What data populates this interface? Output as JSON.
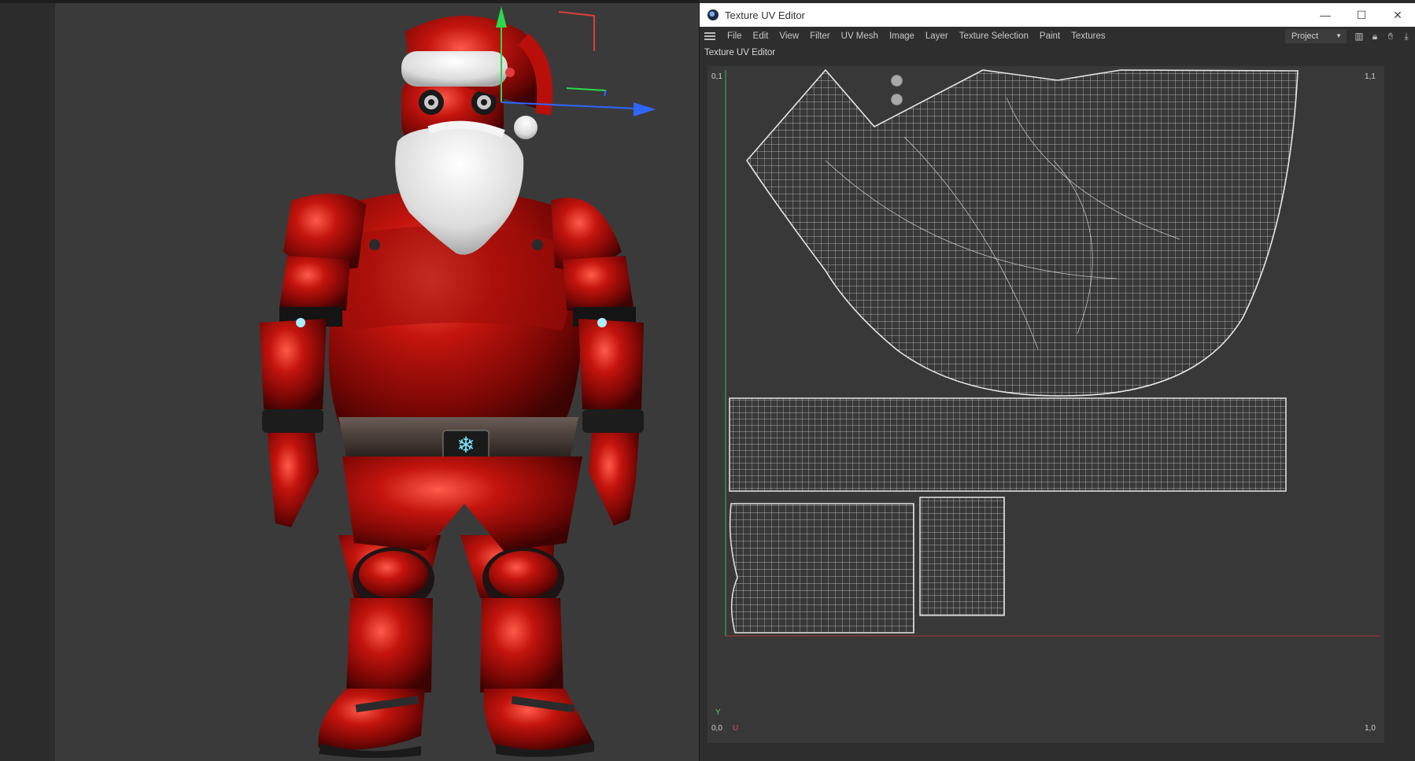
{
  "window": {
    "title": "Texture UV Editor",
    "minimize": "—",
    "maximize": "☐",
    "close": "✕"
  },
  "menu": [
    "File",
    "Edit",
    "View",
    "Filter",
    "UV Mesh",
    "Image",
    "Layer",
    "Texture Selection",
    "Paint",
    "Textures"
  ],
  "project_select": "Project",
  "toolbar_icons": [
    "histogram-icon",
    "lock-icon",
    "hand-icon",
    "pin-icon"
  ],
  "panel_title": "Texture UV Editor",
  "axis": {
    "top_left": "0,1",
    "top_right": "1,1",
    "bottom_left": "0,0",
    "bottom_right": "1,0",
    "u": "U",
    "v": "Y"
  },
  "colors": {
    "suit_red": "#b5110c",
    "beard_white": "#e8e8e8",
    "uv_wire": "#d8d8d8",
    "axis_u": "#b0343a",
    "axis_v": "#3cba5a",
    "gizmo_y": "#2bd84a",
    "gizmo_x": "#2f66ff",
    "gizmo_z": "#e23c3c"
  }
}
